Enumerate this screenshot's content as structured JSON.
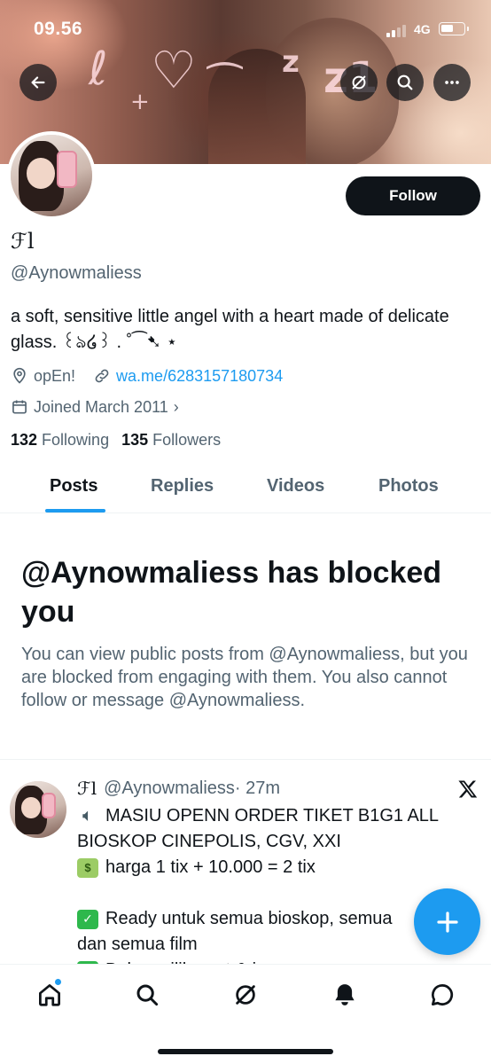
{
  "status_bar": {
    "time": "09.56",
    "network": "4G"
  },
  "banner": {
    "deco_text": "z z1"
  },
  "profile": {
    "follow_label": "Follow",
    "display_name": "ℱl",
    "handle": "@Aynowmaliess",
    "bio": "a soft, sensitive little angel with a heart made of delicate glass. ꒰ঌ໒꒱ . ˚⁀➷ ⋆",
    "location": "opEn!",
    "link": "wa.me/6283157180734",
    "joined": "Joined March 2011",
    "following_count": "132",
    "following_label": "Following",
    "followers_count": "135",
    "followers_label": "Followers"
  },
  "tabs": [
    {
      "label": "Posts",
      "active": true
    },
    {
      "label": "Replies"
    },
    {
      "label": "Videos"
    },
    {
      "label": "Photos"
    }
  ],
  "blocked": {
    "title": "@Aynowmaliess has blocked you",
    "description": "You can view public posts from @Aynowmaliess, but you are blocked from engaging with them. You also cannot follow or message @Aynowmaliess."
  },
  "post": {
    "name": "ℱl",
    "handle": "@Aynowmaliess",
    "time": "· 27m",
    "lines": [
      "MASIU OPENN ORDER TIKET B1G1 ALL",
      "BIOSKOP CINEPOLIS, CGV, XXI",
      "harga 1 tix + 10.000 = 2 tix",
      "Ready untuk semua bioskop, semua",
      "dan semua film",
      "Bebas pilih seat & jam"
    ]
  },
  "icons": {
    "back": "arrow-left-icon",
    "grok": "grok-icon",
    "search": "search-icon",
    "more": "more-icon",
    "location": "location-pin-icon",
    "link": "link-icon",
    "calendar": "calendar-icon",
    "x_logo": "x-logo-icon",
    "compose": "plus-icon",
    "nav": [
      "home-icon",
      "search-icon",
      "grok-icon",
      "bell-icon",
      "chat-icon"
    ]
  },
  "colors": {
    "accent": "#1d9bf0",
    "text": "#0f1419",
    "muted": "#536471",
    "check": "#2eb84c"
  }
}
